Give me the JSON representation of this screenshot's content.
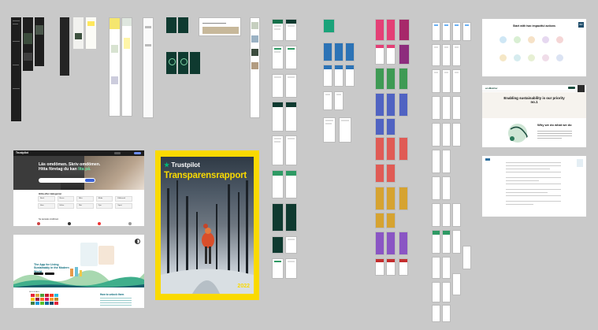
{
  "canvas": {
    "background": "#c9c9c9"
  },
  "columns": [
    {
      "label": "· ·"
    },
    {
      "label": "· ·"
    },
    {
      "label": "· ·"
    },
    {
      "label": "· ·"
    },
    {
      "label": "· ·"
    },
    {
      "label": "· ·"
    },
    {
      "label": "· ·"
    },
    {
      "label": "· ·"
    },
    {
      "label": "· ·"
    },
    {
      "label": "· ·"
    },
    {
      "label": "· ·"
    },
    {
      "label": "· ·"
    }
  ],
  "trustpilot_site": {
    "logo": "Trustpilot",
    "headline_line1": "Läs omdömen. Skriv omdömen.",
    "headline_line2": "Hitta företag du kan ",
    "headline_accent": "lita på.",
    "categories_title": "Hitta efter kategorier",
    "categories": [
      "Bank",
      "Resor",
      "Bilar",
      "Mode",
      "Elektronik",
      "Hem",
      "Hälsa",
      "Mat",
      "Djur",
      "Sport"
    ],
    "recent_title": "Se senaste omdömen",
    "colors": {
      "nav": "#1c1c1c",
      "accent": "#6ee7a5",
      "button": "#3b62d6"
    }
  },
  "sdg_app": {
    "headline": "The App for Living Sustainably in the Modern World",
    "goals_label": "SDG GOALS",
    "how_to": "How to unlock them",
    "goal_colors": [
      "#e5243b",
      "#dda63a",
      "#4c9f38",
      "#c5192d",
      "#ff3a21",
      "#26bde2",
      "#fcc30b",
      "#a21942",
      "#fd6925",
      "#dd1367",
      "#fd9d24",
      "#bf8b2e",
      "#3f7e44",
      "#0a97d9",
      "#56c02b",
      "#00689d",
      "#19486a",
      "#e5243b"
    ]
  },
  "report_cover": {
    "brand": "Trustpilot",
    "title": "Transparensrapport",
    "year": "2022",
    "colors": {
      "background": "#fada00",
      "star": "#00b67a"
    }
  },
  "eco_pages": {
    "first": {
      "headline": "Start with two impactful actions",
      "logo_mark": "BW"
    },
    "second": {
      "nav_brand": "ecoMatcher",
      "headline": "Enabling sustainability is our priority no.1",
      "subhead": "Why we do what we do"
    },
    "third": {
      "title": "Terms"
    }
  }
}
